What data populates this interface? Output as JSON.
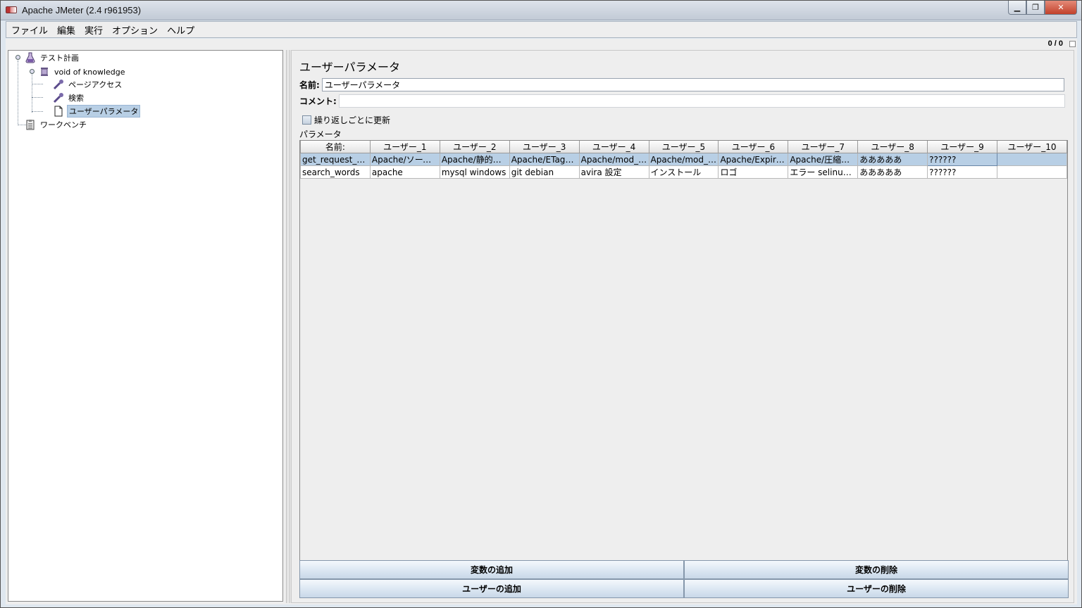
{
  "window": {
    "title": "Apache JMeter (2.4 r961953)",
    "controls": [
      "▁",
      "❐",
      "✕"
    ]
  },
  "menu": [
    "ファイル",
    "編集",
    "実行",
    "オプション",
    "ヘルプ"
  ],
  "status": {
    "counter": "0 / 0"
  },
  "tree": {
    "test_plan": "テスト計画",
    "thread_group": "void of knowledge",
    "page_access": "ページアクセス",
    "search": "検索",
    "user_params": "ユーザーパラメータ",
    "workbench": "ワークベンチ"
  },
  "panel": {
    "title": "ユーザーパラメータ",
    "name_label": "名前:",
    "name_value": "ユーザーパラメータ",
    "comment_label": "コメント:",
    "comment_value": "",
    "update_each_iteration": "繰り返しごとに更新",
    "params_label": "パラメータ"
  },
  "table": {
    "headers": [
      "名前:",
      "ユーザー_1",
      "ユーザー_2",
      "ユーザー_3",
      "ユーザー_4",
      "ユーザー_5",
      "ユーザー_6",
      "ユーザー_7",
      "ユーザー_8",
      "ユーザー_9",
      "ユーザー_10"
    ],
    "rows": [
      [
        "get_request_qu...",
        "Apache/ソース...",
        "Apache/静的組...",
        "Apache/ETagを...",
        "Apache/mod_p...",
        "Apache/mod_p...",
        "Apache/Expires...",
        "Apache/圧縮通...",
        "あああああ",
        "??????",
        ""
      ],
      [
        "search_words",
        "apache",
        "mysql windows",
        "git debian",
        "avira 設定",
        "インストール",
        "ロゴ",
        "エラー selinux c...",
        "あああああ",
        "??????",
        ""
      ]
    ]
  },
  "buttons": {
    "add_variable": "変数の追加",
    "delete_variable": "変数の削除",
    "add_user": "ユーザーの追加",
    "delete_user": "ユーザーの削除"
  }
}
